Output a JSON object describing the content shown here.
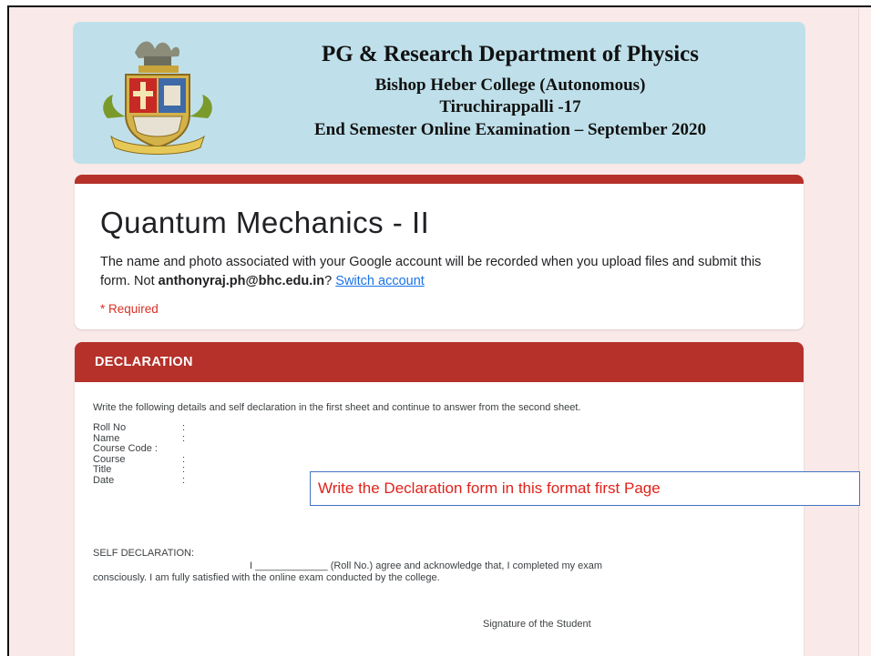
{
  "banner": {
    "title": "PG & Research Department of Physics",
    "college": "Bishop Heber College (Autonomous)",
    "city": "Tiruchirappalli -17",
    "exam": "End Semester Online Examination – September 2020"
  },
  "form": {
    "title": "Quantum Mechanics - II",
    "description_text": "The name and photo associated with your Google account will be recorded when you upload files and submit this form. Not ",
    "email": "anthonyraj.ph@bhc.edu.in",
    "question_mark": "?",
    "switch_account": "Switch account",
    "required": "* Required"
  },
  "declaration": {
    "header": "DECLARATION",
    "intro": "Write the following details and self declaration in the first sheet and continue to answer from the second sheet.",
    "fields": [
      {
        "label": "Roll No",
        "colon": ":"
      },
      {
        "label": "Name",
        "colon": ":"
      },
      {
        "label": "Course Code :",
        "colon": ""
      },
      {
        "label": "Course",
        "colon": ":"
      },
      {
        "label": "Title",
        "colon": ":"
      },
      {
        "label": "Date",
        "colon": ":"
      }
    ],
    "self_title": "SELF DECLARATION:",
    "self_line1": "I _____________ (Roll No.) agree and acknowledge that, I completed my exam",
    "self_line2": "consciously. I am fully satisfied with the online exam conducted by the college.",
    "signature": "Signature of the Student"
  },
  "callout": {
    "text": "Write the Declaration form in this format first Page"
  },
  "colors": {
    "accent": "#b5312a",
    "banner": "#bfe0ea",
    "link": "#1a73e8",
    "required": "#d93025",
    "callout_text": "#e0221b",
    "callout_border": "#4472c4"
  }
}
